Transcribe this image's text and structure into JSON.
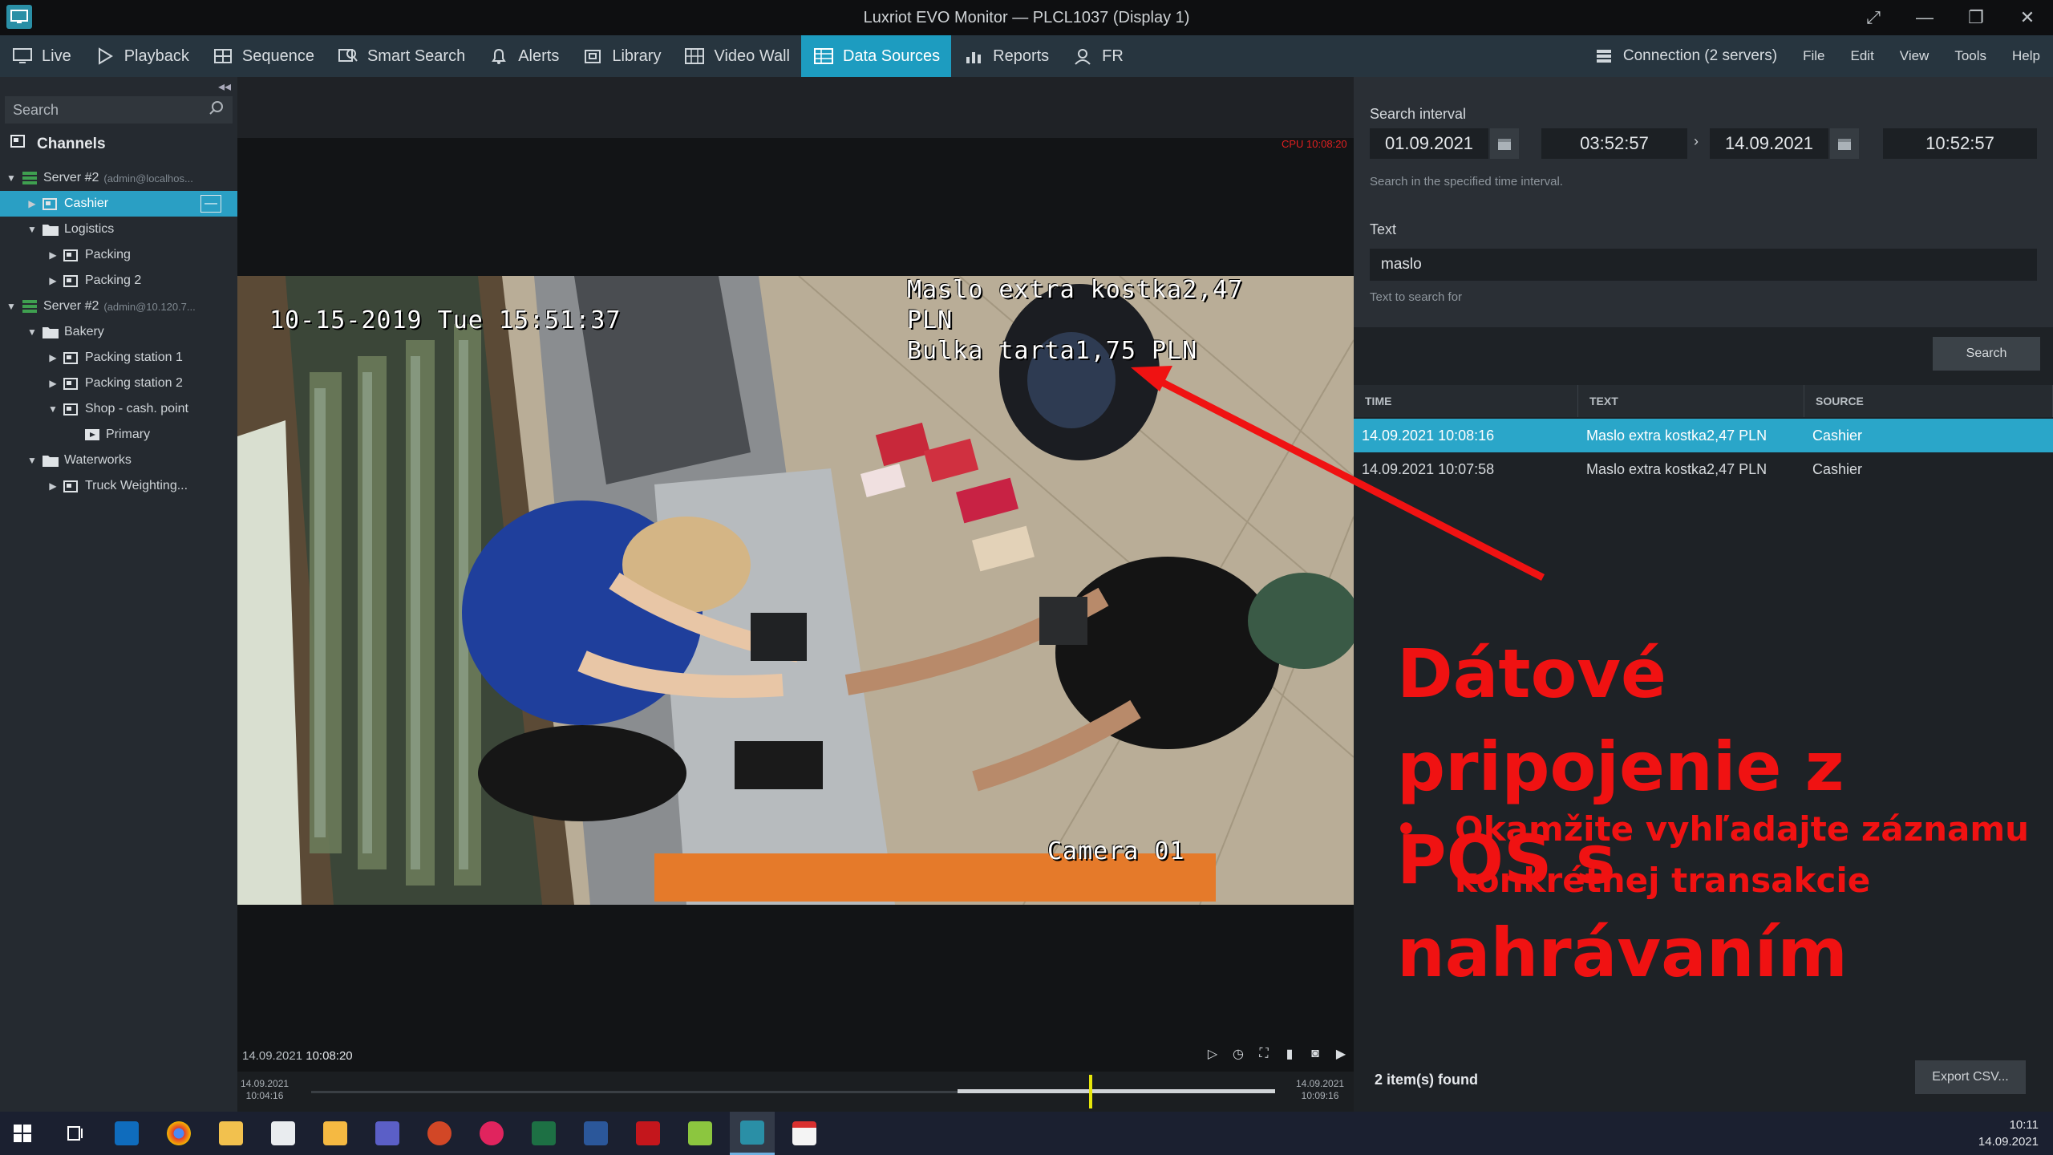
{
  "window": {
    "title": "Luxriot EVO Monitor — PLCL1037 (Display 1)"
  },
  "menu": {
    "items": [
      "Live",
      "Playback",
      "Sequence",
      "Smart Search",
      "Alerts",
      "Library",
      "Video Wall",
      "Data Sources",
      "Reports",
      "FR"
    ],
    "active": "Data Sources",
    "right": [
      "Connection (2 servers)",
      "File",
      "Edit",
      "View",
      "Tools",
      "Help"
    ]
  },
  "sidebar": {
    "search_placeholder": "Search",
    "channels_label": "Channels",
    "tree": [
      {
        "label": "Server #2",
        "sub": "(admin@localhos...",
        "type": "server",
        "level": 0,
        "expanded": true
      },
      {
        "label": "Cashier",
        "type": "camera",
        "level": 1,
        "selected": true
      },
      {
        "label": "Logistics",
        "type": "folder",
        "level": 1,
        "expanded": true
      },
      {
        "label": "Packing",
        "type": "camera",
        "level": 2
      },
      {
        "label": "Packing 2",
        "type": "camera",
        "level": 2
      },
      {
        "label": "Server #2",
        "sub": "(admin@10.120.7...",
        "type": "server",
        "level": 0,
        "expanded": true
      },
      {
        "label": "Bakery",
        "type": "folder",
        "level": 1,
        "expanded": true
      },
      {
        "label": "Packing station 1",
        "type": "camera",
        "level": 2
      },
      {
        "label": "Packing station 2",
        "type": "camera",
        "level": 2
      },
      {
        "label": "Shop - cash. point",
        "type": "camera",
        "level": 2,
        "expanded": true
      },
      {
        "label": "Primary",
        "type": "stream",
        "level": 3
      },
      {
        "label": "Waterworks",
        "type": "folder",
        "level": 1,
        "expanded": true
      },
      {
        "label": "Truck Weighting...",
        "type": "camera",
        "level": 2
      }
    ]
  },
  "video": {
    "cpu": "CPU 10:08:20",
    "osd_datetime": "10-15-2019 Tue 15:51:37",
    "osd_receipt_line1": "Maslo extra kostka2,47",
    "osd_receipt_line2": "PLN",
    "osd_receipt_line3": "Bulka tarta1,75 PLN",
    "osd_camera": "Camera 01",
    "playback_time_date": "14.09.2021",
    "playback_time_clock": "10:08:20",
    "timeline_start_date": "14.09.2021",
    "timeline_start_time": "10:04:16",
    "timeline_end_date": "14.09.2021",
    "timeline_end_time": "10:09:16",
    "timeline_position": 0.81
  },
  "search_panel": {
    "interval_label": "Search interval",
    "from_date": "01.09.2021",
    "from_time": "03:52:57",
    "to_date": "14.09.2021",
    "to_time": "10:52:57",
    "interval_hint": "Search in the specified time interval.",
    "text_label": "Text",
    "text_value": "maslo",
    "text_hint": "Text to search for",
    "search_button": "Search",
    "columns": [
      "TIME",
      "TEXT",
      "SOURCE"
    ],
    "rows": [
      {
        "time": "14.09.2021 10:08:16",
        "text": "Maslo extra kostka2,47 PLN",
        "source": "Cashier"
      },
      {
        "time": "14.09.2021 10:07:58",
        "text": "Maslo extra kostka2,47 PLN",
        "source": "Cashier"
      }
    ],
    "items_found": "2 item(s) found",
    "export_button": "Export CSV..."
  },
  "overlay": {
    "title_line1": "Dátové pripojenie z",
    "title_line2": "POS s nahrávaním",
    "bullet_line1": "Okamžite vyhľadajte záznamu",
    "bullet_line2": "konkrétnej transakcie",
    "color": "#f01212"
  },
  "taskbar": {
    "clock_time": "10:11",
    "clock_date": "14.09.2021",
    "apps": [
      "start-icon",
      "task-view-icon",
      "outlook-icon",
      "chrome-icon",
      "file-explorer-icon",
      "notepad-icon",
      "folder-icon",
      "teams-icon",
      "powerpoint-icon",
      "app-icon",
      "excel-icon",
      "word-icon",
      "acrobat-icon",
      "sheets-icon",
      "luxriot-icon",
      "calendar-icon"
    ]
  },
  "colors": {
    "accent": "#1d9cc0",
    "selection": "#2aa6c9",
    "menubar": "#27353f"
  }
}
